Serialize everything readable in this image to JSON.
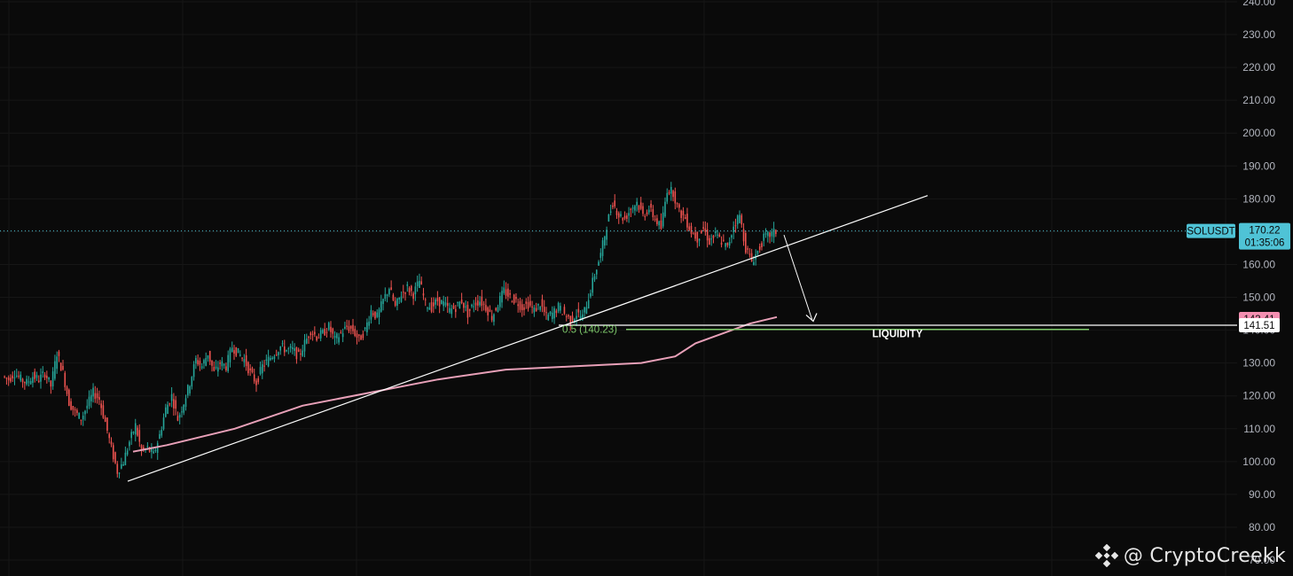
{
  "chart_data": {
    "type": "candlestick",
    "symbol": "SOLUSDT",
    "last_price": "170.22",
    "countdown": "01:35:06",
    "y_ticks": [
      "240.00",
      "230.00",
      "220.00",
      "210.00",
      "200.00",
      "190.00",
      "180.00",
      "170.00",
      "160.00",
      "150.00",
      "140.00",
      "130.00",
      "120.00",
      "110.00",
      "100.00",
      "90.00",
      "80.00",
      "70.00"
    ],
    "ylim": [
      70,
      240
    ],
    "grid": true,
    "price_path": [
      126,
      125,
      127,
      125,
      124,
      126,
      125,
      127,
      123,
      133,
      127,
      118,
      115,
      113,
      117,
      121,
      119,
      112,
      104,
      97,
      100,
      106,
      111,
      103,
      104,
      102,
      108,
      116,
      120,
      113,
      118,
      124,
      131,
      129,
      133,
      127,
      130,
      129,
      135,
      133,
      131,
      127,
      124,
      129,
      131,
      133,
      135,
      134,
      134,
      132,
      136,
      140,
      138,
      139,
      141,
      137,
      139,
      141,
      140,
      137,
      140,
      146,
      144,
      149,
      153,
      147,
      151,
      153,
      151,
      155,
      148,
      147,
      149,
      148,
      146,
      147,
      149,
      145,
      148,
      149,
      147,
      144,
      148,
      152,
      150,
      149,
      147,
      148,
      146,
      148,
      144,
      145,
      147,
      145,
      143,
      145,
      144,
      150,
      157,
      163,
      172,
      179,
      175,
      174,
      177,
      179,
      175,
      177,
      174,
      171,
      183,
      182,
      176,
      174,
      170,
      168,
      171,
      167,
      169,
      167,
      165,
      172,
      175,
      165,
      161,
      164,
      168,
      169,
      170
    ],
    "vwap_path": [
      [
        0.05,
        103
      ],
      [
        0.1,
        105
      ],
      [
        0.2,
        110
      ],
      [
        0.3,
        117
      ],
      [
        0.4,
        121
      ],
      [
        0.5,
        125
      ],
      [
        0.6,
        128
      ],
      [
        0.7,
        129
      ],
      [
        0.8,
        130
      ],
      [
        0.85,
        132
      ],
      [
        0.88,
        136
      ],
      [
        0.92,
        139
      ],
      [
        0.96,
        142
      ],
      [
        1.0,
        144
      ]
    ],
    "trendline": {
      "from": [
        0,
        94
      ],
      "to": [
        1,
        181
      ]
    },
    "projection_arrow": {
      "from": [
        0,
        169
      ],
      "to": [
        1,
        143
      ]
    },
    "fib_label": "0.5 (140.23)",
    "fib_level": 140.23,
    "liquidity_label": "LIQUIDITY",
    "level_white": "141.51",
    "level_pink": "143.41",
    "colors": {
      "up": "#26a69a",
      "down": "#ef5350",
      "vwap": "#e8a0b8",
      "tag_symbol": "#4fc3d6",
      "tag_pink": "#f48fb1",
      "tag_white": "#ffffff",
      "green_line": "#7ec96b"
    }
  },
  "watermark": {
    "handle": "@ CryptoCreekk",
    "icon": "binance-logo-icon"
  }
}
